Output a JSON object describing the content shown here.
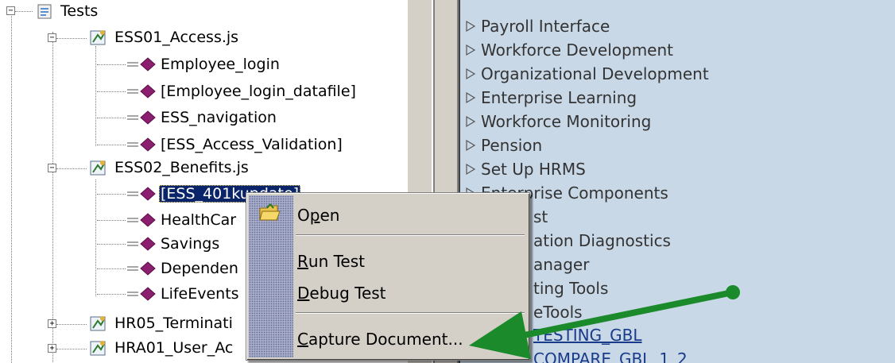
{
  "tree": {
    "root_label": "Tests",
    "files": [
      {
        "label": "ESS01_Access.js",
        "items": [
          "Employee_login",
          "[Employee_login_datafile]",
          "ESS_navigation",
          "[ESS_Access_Validation]"
        ]
      },
      {
        "label": "ESS02_Benefits.js",
        "items": [
          "[ESS_401k",
          "HealthCar",
          "Savings",
          "Dependen",
          "LifeEvents"
        ]
      },
      {
        "label": "HR05_Terminati"
      },
      {
        "label": "HRA01_User_Ac"
      }
    ],
    "selected_suffix": "update]"
  },
  "menu": {
    "items": [
      "Payroll Interface",
      "Workforce Development",
      "Organizational Development",
      "Enterprise Learning",
      "Workforce Monitoring",
      "Pension",
      "Set Up HRMS",
      "Enterprise Components"
    ],
    "partial_items": [
      "st",
      "ation Diagnostics",
      "anager",
      "ting Tools",
      "eTools"
    ],
    "links": [
      "TESTING_GBL",
      "COMPARE_GBL_1_2"
    ]
  },
  "context_menu": {
    "open": {
      "pre": "O",
      "u": "p",
      "post": "en"
    },
    "run_test": {
      "pre": "",
      "u": "R",
      "post": "un Test"
    },
    "debug_test": {
      "pre": "",
      "u": "D",
      "post": "ebug Test"
    },
    "capture_document": {
      "pre": "",
      "u": "C",
      "post": "apture Document..."
    }
  },
  "colors": {
    "selection": "#0a246a",
    "menu_bg": "#c9d8e7",
    "arrow": "#1a8a2a",
    "function_icon": "#8b1e6e"
  }
}
